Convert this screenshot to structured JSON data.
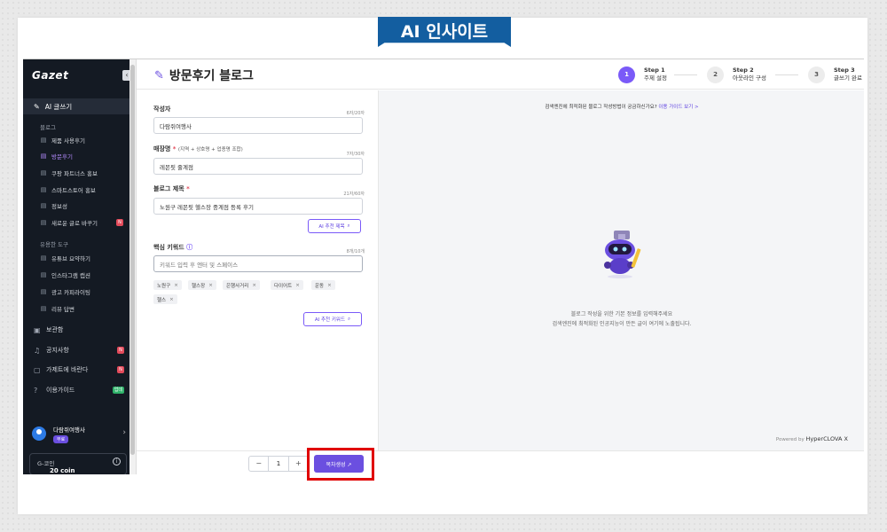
{
  "banner": {
    "title": "AI 인사이트"
  },
  "sidebar": {
    "logo": "Gazet",
    "collapse": "‹",
    "main_item": "AI 글쓰기",
    "section_blog": "블로그",
    "blog_items": [
      {
        "label": "제품 사용후기",
        "active": false
      },
      {
        "label": "방문후기",
        "active": true
      },
      {
        "label": "쿠팡 파트너스 홍보",
        "active": false
      },
      {
        "label": "스마트스토어 홍보",
        "active": false
      },
      {
        "label": "정보성",
        "active": false
      },
      {
        "label": "새로운 글로 바꾸기",
        "active": false,
        "badge": "N"
      }
    ],
    "section_tools": "유용한 도구",
    "tool_items": [
      {
        "label": "유튜브 요약하기"
      },
      {
        "label": "인스타그램 캡션"
      },
      {
        "label": "광고 카피라이팅"
      },
      {
        "label": "리뷰 답변"
      }
    ],
    "top_items": [
      {
        "label": "보관함"
      },
      {
        "label": "공지사항",
        "badge": "N",
        "badge_color": "red"
      },
      {
        "label": "가제트에 바란다",
        "badge": "N",
        "badge_color": "red"
      },
      {
        "label": "이용가이드",
        "badge": "업데",
        "badge_color": "green"
      }
    ],
    "user": {
      "name": "다람쥐여행사",
      "plan": "무료"
    },
    "coin": {
      "label": "G-코인",
      "value": "20 coin"
    }
  },
  "header": {
    "title": "방문후기 블로그",
    "steps": [
      {
        "num": "1",
        "step": "Step 1",
        "label": "주제 설정",
        "active": true
      },
      {
        "num": "2",
        "step": "Step 2",
        "label": "아웃라인 구성",
        "active": false
      },
      {
        "num": "3",
        "step": "Step 3",
        "label": "글쓰기 완료",
        "active": false
      }
    ]
  },
  "form": {
    "author": {
      "label": "작성자",
      "count": "6자/20자",
      "value": "다람쥐여행사"
    },
    "store": {
      "label": "매장명",
      "hint": "(지역 + 상호명 + 업종명 조합)",
      "count": "7자/30자",
      "value": "레몬핏 줄계점"
    },
    "blog_title": {
      "label": "블로그 제목",
      "count": "21자/60자",
      "value": "노원구 레몬핏 헬스장 중계점 등록 후기",
      "ai_button": "AI 추천 제목"
    },
    "keywords": {
      "label": "핵심 키워드",
      "count": "8개/10개",
      "placeholder": "키워드 입력 후 엔터 및 스페이스",
      "tags": [
        "노원구",
        "헬스장",
        "은행사거리",
        "다이어트",
        "운동",
        "헬스"
      ],
      "ai_button": "AI 추천 키워드"
    }
  },
  "bottom": {
    "quantity": "1",
    "minus": "−",
    "plus": "+",
    "generate": "목차생성 ↗"
  },
  "preview": {
    "guide_text": "검색엔진에 최적화된 블로그 작성방법이 궁금하신가요?",
    "guide_link": "이용 가이드 보기 >",
    "empty_line1": "블로그 작성을 위한 기본 정보를 입력해주세요",
    "empty_line2": "검색엔진에 최적화된 인공지능이 만든 글이 여기에 노출됩니다.",
    "powered_prefix": "Powered by",
    "powered_brand": "HyperCLOVA X"
  },
  "colors": {
    "accent": "#6b4fe0",
    "sidebar_bg": "#141a23",
    "banner": "#135ea0",
    "highlight": "#e00000"
  }
}
